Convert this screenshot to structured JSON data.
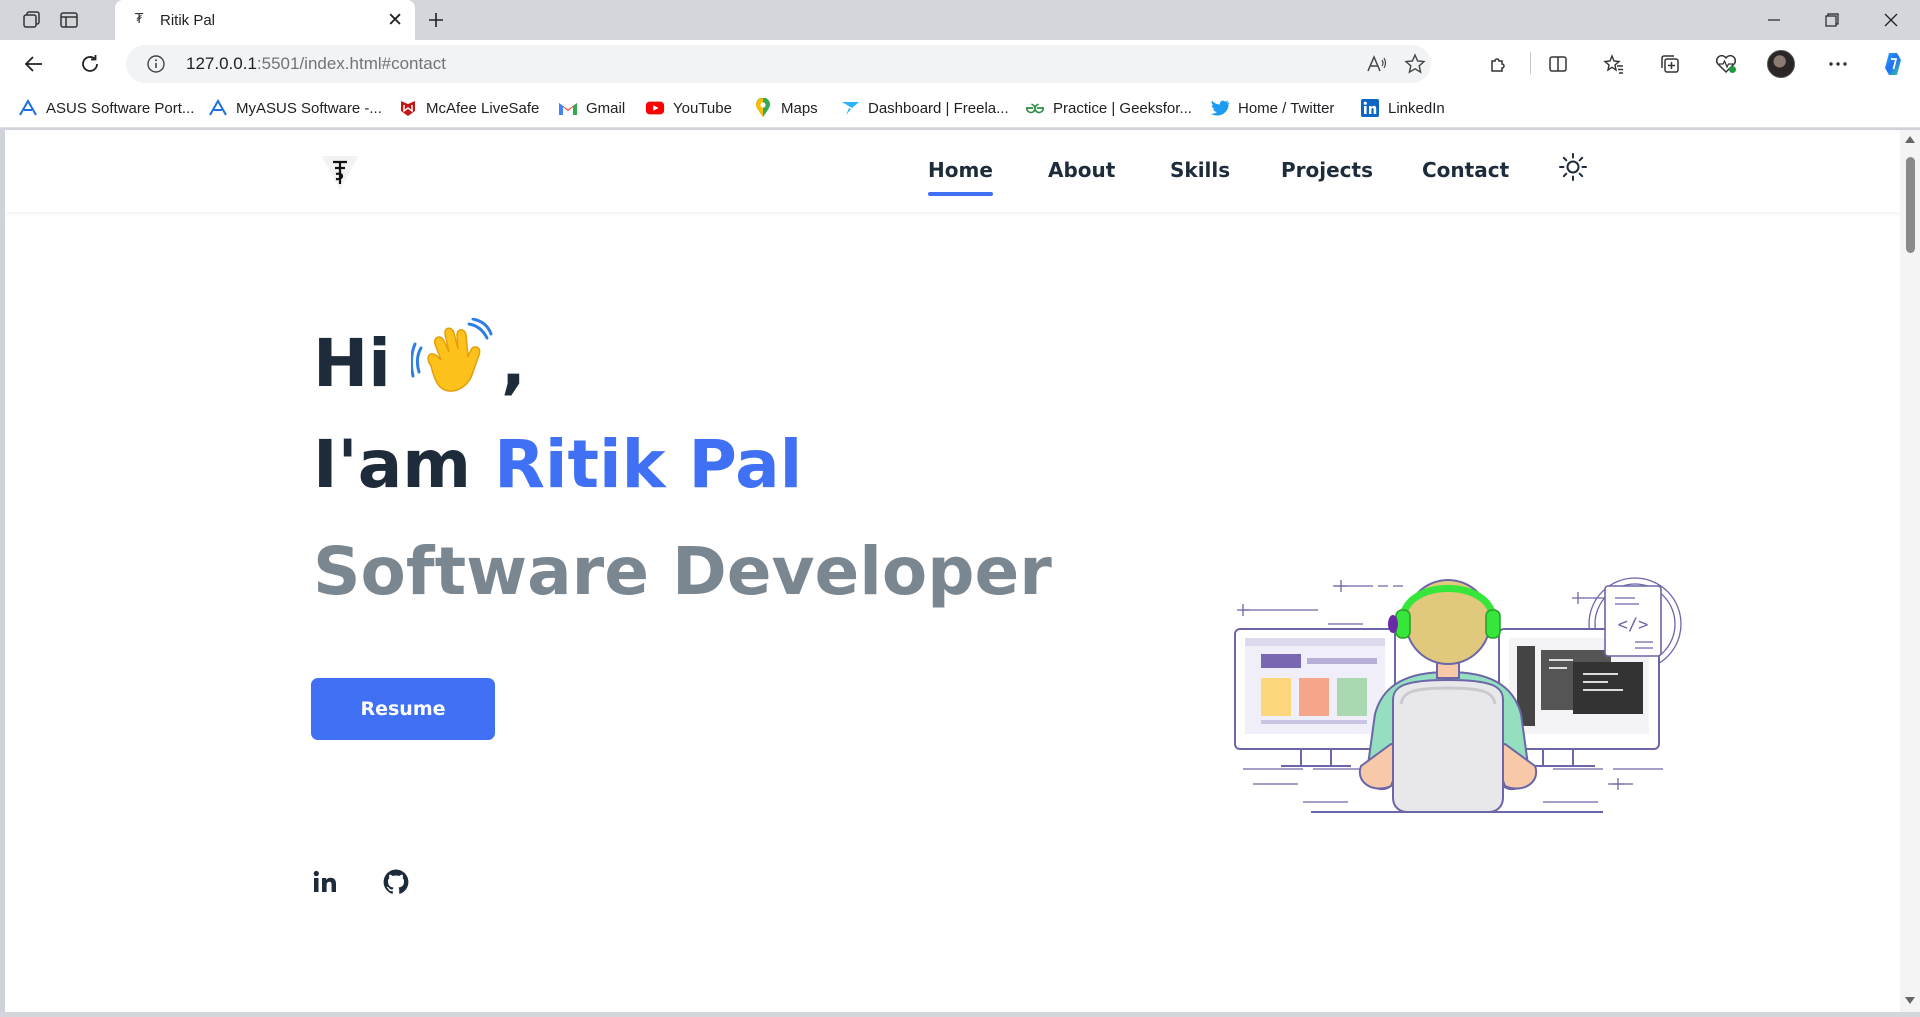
{
  "browser": {
    "tab_title": "Ritik Pal",
    "tab_favicon": "₮",
    "url_host": "127.0.0.1",
    "url_rest": ":5501/index.html#contact",
    "bookmarks": [
      {
        "label": "ASUS Software Port...",
        "icon": "asus-icon"
      },
      {
        "label": "MyASUS Software -...",
        "icon": "asus-icon"
      },
      {
        "label": "McAfee LiveSafe",
        "icon": "mcafee-icon"
      },
      {
        "label": "Gmail",
        "icon": "gmail-icon"
      },
      {
        "label": "YouTube",
        "icon": "youtube-icon"
      },
      {
        "label": "Maps",
        "icon": "maps-icon"
      },
      {
        "label": "Dashboard | Freela...",
        "icon": "freelancer-icon"
      },
      {
        "label": "Practice | Geeksfor...",
        "icon": "geeksforgeeks-icon"
      },
      {
        "label": "Home / Twitter",
        "icon": "twitter-icon"
      },
      {
        "label": "LinkedIn",
        "icon": "linkedin-icon"
      }
    ]
  },
  "nav": {
    "logo": "₮",
    "items": [
      "Home",
      "About",
      "Skills",
      "Projects",
      "Contact"
    ],
    "active": "Home"
  },
  "hero": {
    "greeting": "Hi",
    "greeting_suffix": ",",
    "intro": "I'am",
    "name": "Ritik Pal",
    "role": "Software Developer",
    "resume_label": "Resume"
  },
  "social": {
    "links": [
      "linkedin-icon",
      "github-icon"
    ]
  },
  "colors": {
    "accent": "#4070f4",
    "heading": "#1d2b3a",
    "subheading": "#7a8791"
  }
}
